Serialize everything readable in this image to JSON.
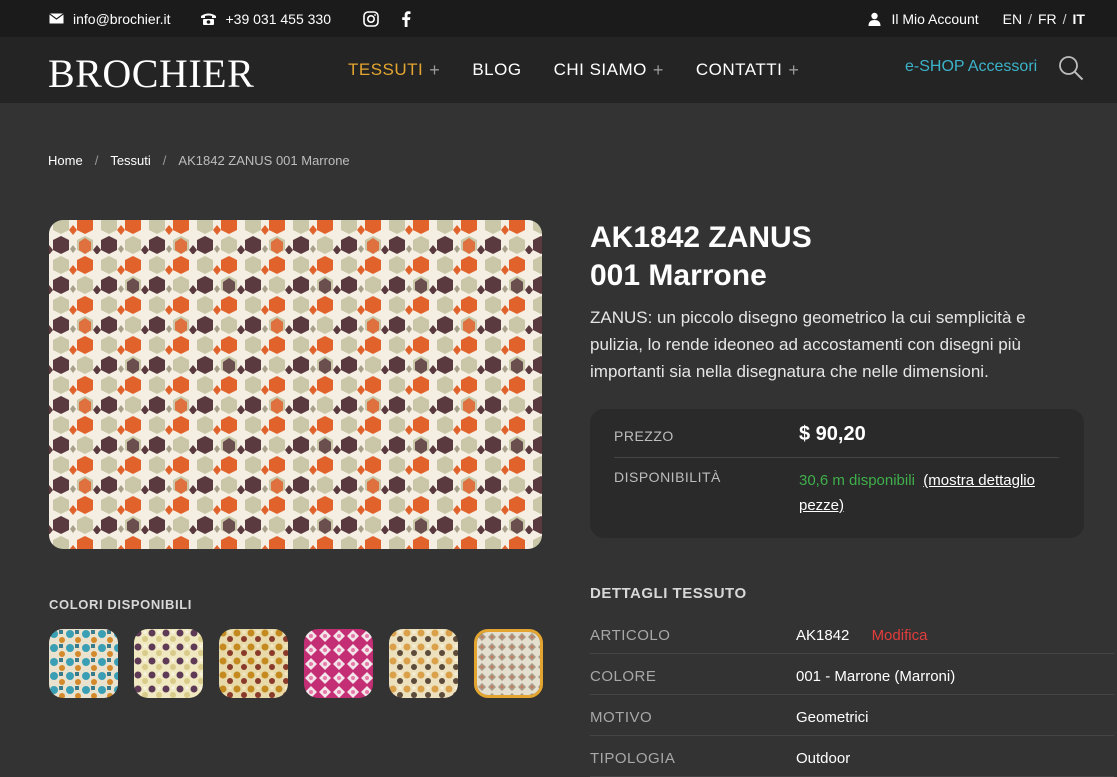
{
  "topbar": {
    "email": "info@brochier.it",
    "phone": "+39 031 455 330",
    "account": "Il Mio Account",
    "languages": [
      "EN",
      "FR",
      "IT"
    ],
    "language_separator": "/"
  },
  "header": {
    "logo": "BROCHIER",
    "nav": [
      {
        "label": "TESSUTI",
        "plus": "+"
      },
      {
        "label": "BLOG",
        "plus": ""
      },
      {
        "label": "CHI SIAMO",
        "plus": "+"
      },
      {
        "label": "CONTATTI",
        "plus": "+"
      }
    ],
    "eshop": "e-SHOP Accessori"
  },
  "breadcrumb": {
    "items": [
      "Home",
      "Tessuti",
      "AK1842 ZANUS 001 Marrone"
    ],
    "separator": "/"
  },
  "product": {
    "title_line1": "AK1842 ZANUS",
    "title_line2": "001 Marrone",
    "description": "ZANUS: un piccolo disegno geometrico la cui semplicità e pulizia, lo rende ideoneo ad accostamenti con disegni più importanti sia nella disegnatura che nelle dimensioni.",
    "price_label": "PREZZO",
    "price_value": "$ 90,20",
    "availability_label": "DISPONIBILITÀ",
    "availability_value": "30,6 m disponibili",
    "availability_link": "(mostra dettaglio pezze)"
  },
  "colors": {
    "label": "COLORI DISPONIBILI",
    "swatches": [
      {
        "name": "teal",
        "c1": "#e9e2cf",
        "c2": "#3a9fb5",
        "c3": "#d48a2a"
      },
      {
        "name": "purple-cream",
        "c1": "#efe8c0",
        "c2": "#5e3a56",
        "c3": "#d9cc8a"
      },
      {
        "name": "mustard",
        "c1": "#e7d9a8",
        "c2": "#c58a1f",
        "c3": "#8a3a2a"
      },
      {
        "name": "pink",
        "c1": "#f3e5ea",
        "c2": "#c42e74",
        "c3": "#e57aa8"
      },
      {
        "name": "ochre",
        "c1": "#ece0bd",
        "c2": "#dba14a",
        "c3": "#5c4a3a"
      },
      {
        "name": "brown-selected",
        "c1": "#e5dfcf",
        "c2": "#a89a86",
        "c3": "#c97a5a"
      }
    ]
  },
  "details": {
    "title": "DETTAGLI TESSUTO",
    "rows": [
      {
        "key": "ARTICOLO",
        "value": "AK1842",
        "extra": "Modifica"
      },
      {
        "key": "COLORE",
        "value": "001 - Marrone (Marroni)",
        "extra": ""
      },
      {
        "key": "MOTIVO",
        "value": "Geometrici",
        "extra": ""
      },
      {
        "key": "TIPOLOGIA",
        "value": "Outdoor",
        "extra": ""
      }
    ]
  },
  "palette": {
    "accent": "#e3a52f",
    "link": "#3bb3c9",
    "available": "#3fae4b",
    "edit": "#e23c3c",
    "fabric_orange": "#e2622c",
    "fabric_plum": "#5a3a3f",
    "fabric_sage": "#c9c7a8",
    "fabric_cream": "#f4efe2"
  }
}
